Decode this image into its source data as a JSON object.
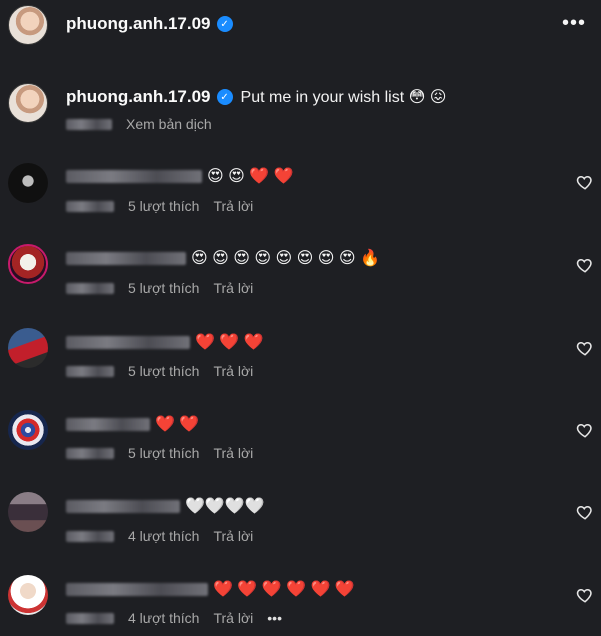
{
  "post": {
    "username": "phuong.anh.17.09",
    "caption_username": "phuong.anh.17.09",
    "caption_text": "Put me in your wish list 😳 😖",
    "translate_label": "Xem bản dịch"
  },
  "comments": [
    {
      "emojis": "😍 😍 ❤️ ❤️",
      "likes": "5 lượt thích",
      "reply": "Trả lời"
    },
    {
      "emojis": "😍 😍 😍 😍 😍 😍 😍 😍 🔥",
      "likes": "5 lượt thích",
      "reply": "Trả lời"
    },
    {
      "emojis": "❤️ ❤️ ❤️",
      "likes": "5 lượt thích",
      "reply": "Trả lời"
    },
    {
      "emojis": "❤️ ❤️",
      "likes": "5 lượt thích",
      "reply": "Trả lời"
    },
    {
      "emojis": "🤍🤍🤍🤍",
      "likes": "4 lượt thích",
      "reply": "Trả lời"
    },
    {
      "emojis": "❤️ ❤️ ❤️ ❤️ ❤️ ❤️",
      "likes": "4 lượt thích",
      "reply": "Trả lời"
    }
  ],
  "icons": {
    "verified": "verified-badge-icon",
    "more": "more-options-icon",
    "like": "heart-outline-icon"
  },
  "colors": {
    "background": "#1e1f23",
    "verified": "#1a8cff",
    "meta_text": "#a8a8a8"
  }
}
